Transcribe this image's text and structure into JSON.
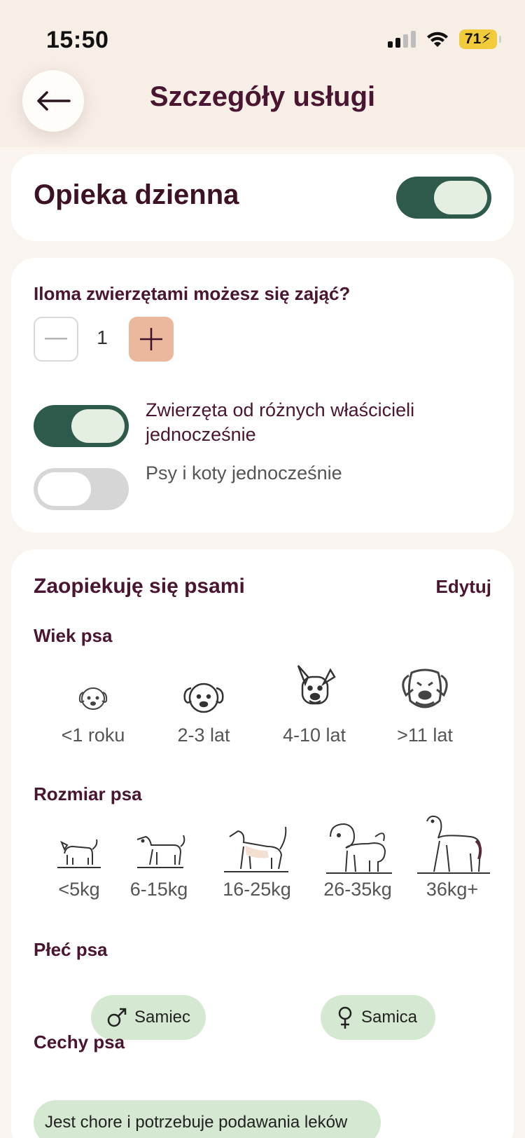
{
  "status_bar": {
    "time": "15:50",
    "battery": "71"
  },
  "header": {
    "title": "Szczegóły usługi",
    "back_icon": "arrow-left-icon"
  },
  "service": {
    "name": "Opieka dzienna",
    "enabled": true
  },
  "capacity": {
    "question": "Iloma zwierzętami możesz się zająć?",
    "value": "1",
    "options": [
      {
        "label": "Zwierzęta od różnych właścicieli jednocześnie",
        "enabled": true
      },
      {
        "label": "Psy i koty jednocześnie",
        "enabled": false
      }
    ]
  },
  "dogs": {
    "title": "Zaopiekuję się psami",
    "edit_label": "Edytuj",
    "age": {
      "title": "Wiek psa",
      "items": [
        {
          "label": "<1 roku",
          "icon": "puppy-icon"
        },
        {
          "label": "2-3 lat",
          "icon": "young-dog-icon"
        },
        {
          "label": "4-10 lat",
          "icon": "adult-dog-icon"
        },
        {
          "label": ">11 lat",
          "icon": "senior-dog-icon"
        }
      ]
    },
    "size": {
      "title": "Rozmiar psa",
      "items": [
        {
          "label": "<5kg",
          "icon": "tiny-dog-icon"
        },
        {
          "label": "6-15kg",
          "icon": "small-dog-icon"
        },
        {
          "label": "16-25kg",
          "icon": "medium-dog-icon"
        },
        {
          "label": "26-35kg",
          "icon": "large-dog-icon"
        },
        {
          "label": "36kg+",
          "icon": "giant-dog-icon"
        }
      ]
    },
    "sex": {
      "title": "Płeć psa",
      "items": [
        {
          "label": "Samiec",
          "icon": "male-symbol-icon"
        },
        {
          "label": "Samica",
          "icon": "female-symbol-icon"
        }
      ]
    },
    "traits": {
      "title": "Cechy psa",
      "items": [
        {
          "label": "Jest chore i potrzebuje podawania leków"
        }
      ]
    }
  },
  "colors": {
    "brand_dark": "#4a1530",
    "toggle_on": "#2d5a4a",
    "accent": "#ecb89d",
    "chip": "#d5e8d1"
  }
}
